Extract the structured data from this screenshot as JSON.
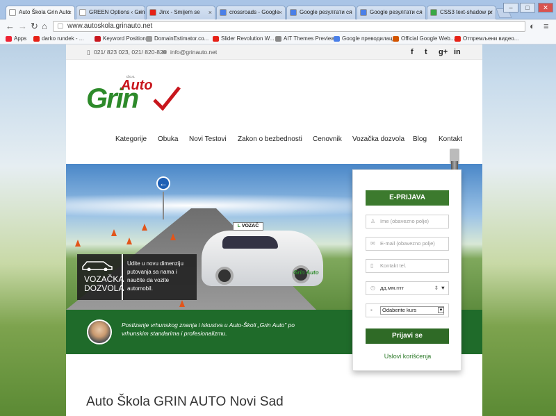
{
  "browser": {
    "tabs": [
      {
        "label": "Auto Škola Grin Auto",
        "color": "#ffffff"
      },
      {
        "label": "GREEN Options ‹ Grin",
        "color": "#ffffff"
      },
      {
        "label": "Jinx - Smijem se",
        "color": "#e62117"
      },
      {
        "label": "crossroads - Google",
        "color": "#4a7fe8"
      },
      {
        "label": "Google резултати сл",
        "color": "#4a7fe8"
      },
      {
        "label": "Google резултати сл",
        "color": "#4a7fe8"
      },
      {
        "label": "CSS3 text-shadow pr",
        "color": "#39a845"
      }
    ],
    "url": "www.autoskola.grinauto.net",
    "bookmarks": [
      "Apps",
      "darko rundek - ...",
      "Keyword Position",
      "DomainEstimator.co...",
      "Slider Revolution W...",
      "AIT Themes Preview...",
      "Google преводилац",
      "Official Google Web...",
      "Отпремљени видео..."
    ]
  },
  "topbar": {
    "phone": "021/ 823 023, 021/ 820-820",
    "email": "info@grinauto.net",
    "social": [
      "f",
      "t",
      "g+",
      "in"
    ]
  },
  "logo": {
    "text": "Grin",
    "sup": "Auto",
    "small": "d.o.o."
  },
  "nav": [
    "Kategorije",
    "Obuka",
    "Novi Testovi",
    "Zakon o bezbednosti",
    "Cenovnik",
    "Vozačka dozvola",
    "Blog",
    "Kontakt"
  ],
  "hero": {
    "badge_line1": "VOZAČKA",
    "badge_line2": "DOZVOLA",
    "badge_text": "Udite u novu dimenziju putovanja sa nama i naučite da vozite automobil.",
    "car_sign": "VOZAČ",
    "car_brand": "Grin Auto"
  },
  "quote": "Postizanje vrhunskog znanja i iskustva u Auto-Školi „Grin Auto\" po vrhunskim standarima i profesionalizmu.",
  "form": {
    "header": "E-PRIJAVA",
    "name_placeholder": "Ime (obavezno polje)",
    "email_placeholder": "E-mail (obavezno polje)",
    "phone_placeholder": "Kontakt tel.",
    "date_placeholder": "дд.мм.гггг",
    "course_select": "Odaberite kurs",
    "submit": "Prijavi se",
    "terms": "Uslovi korišćenja"
  },
  "page_title": "Auto Škola GRIN AUTO Novi Sad"
}
